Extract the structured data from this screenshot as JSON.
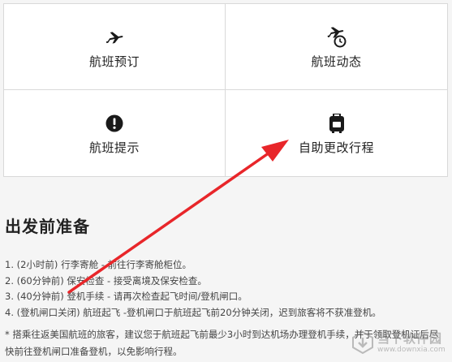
{
  "tiles": [
    {
      "label": "航班预订",
      "icon": "plane-icon"
    },
    {
      "label": "航班动态",
      "icon": "flight-status-icon"
    },
    {
      "label": "航班提示",
      "icon": "alert-icon"
    },
    {
      "label": "自助更改行程",
      "icon": "luggage-icon"
    }
  ],
  "section": {
    "title": "出发前准备",
    "steps": [
      "1. (2小时前) 行李寄舱 - 前往行李寄舱柜位。",
      "2. (60分钟前) 保安检查 - 接受离境及保安检查。",
      "3. (40分钟前) 登机手续 - 请再次检查起飞时间/登机闸口。",
      "4. (登机闸口关闭) 航班起飞 -登机闸口于航班起飞前20分钟关闭，迟到旅客将不获准登机。"
    ],
    "note": "* 搭乘往返美国航班的旅客，建议您于航班起飞前最少3小时到达机场办理登机手续，并于领取登机证后尽快前往登机闸口准备登机，以免影响行程。"
  },
  "watermark": {
    "name": "当下软件园",
    "url": "www.downxia.com"
  },
  "colors": {
    "arrow": "#e8262a",
    "icon": "#1a1a1a",
    "border": "#d9d9d9",
    "background": "#f5f5f5"
  }
}
